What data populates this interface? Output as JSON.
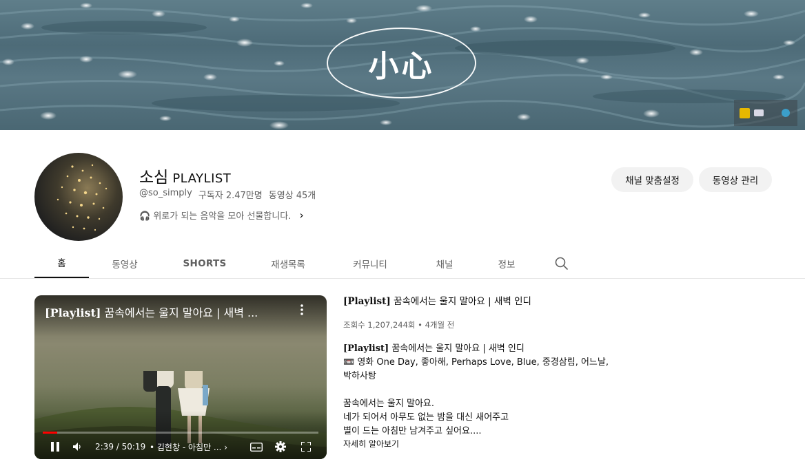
{
  "banner": {
    "logo_text": "小心",
    "links": [
      "link-icon-1",
      "mail-icon",
      "link-icon-3"
    ]
  },
  "channel": {
    "name_hangul": "소심",
    "name_latin": "PLAYLIST",
    "handle": "@so_simply",
    "subscribers": "구독자 2.47만명",
    "video_count": "동영상 45개",
    "description": "🎧 위로가 되는 음악을 모아 선물합니다.",
    "description_more": "›"
  },
  "buttons": {
    "customize": "채널 맞춤설정",
    "manage": "동영상 관리"
  },
  "tabs": [
    {
      "label": "홈",
      "active": true
    },
    {
      "label": "동영상",
      "active": false
    },
    {
      "label": "SHORTS",
      "active": false
    },
    {
      "label": "재생목록",
      "active": false
    },
    {
      "label": "커뮤니티",
      "active": false
    },
    {
      "label": "채널",
      "active": false
    },
    {
      "label": "정보",
      "active": false
    }
  ],
  "player": {
    "title_prefix": "[Playlist]",
    "title_rest": " 꿈속에서는 울지 말아요 | 새벽 ...",
    "time": "2:39 / 50:19",
    "chapter": "• 김현창 - 아침만 ...",
    "chapter_arrow": "›",
    "progress_fraction": 0.053
  },
  "featured": {
    "title_prefix": "[Playlist]",
    "title_rest": " 꿈속에서는 울지 말아요 | 새벽 인디",
    "stats": "조회수 1,207,244회 • 4개월 전",
    "desc_line1_prefix": "[Playlist]",
    "desc_line1_rest": " 꿈속에서는 울지 말아요 | 새벽 인디",
    "desc_line2": "📼 영화 One Day, 좋아해, Perhaps Love, Blue, 중경삼림, 어느날,",
    "desc_line3": "박하사탕",
    "desc_line4": "꿈속에서는 울지 말아요.",
    "desc_line5": "네가 되어서 아무도 없는 밤을 대신 새어주고",
    "desc_line6": "별이 드는 아침만 남겨주고 싶어요....",
    "more": "자세히 알아보기"
  }
}
